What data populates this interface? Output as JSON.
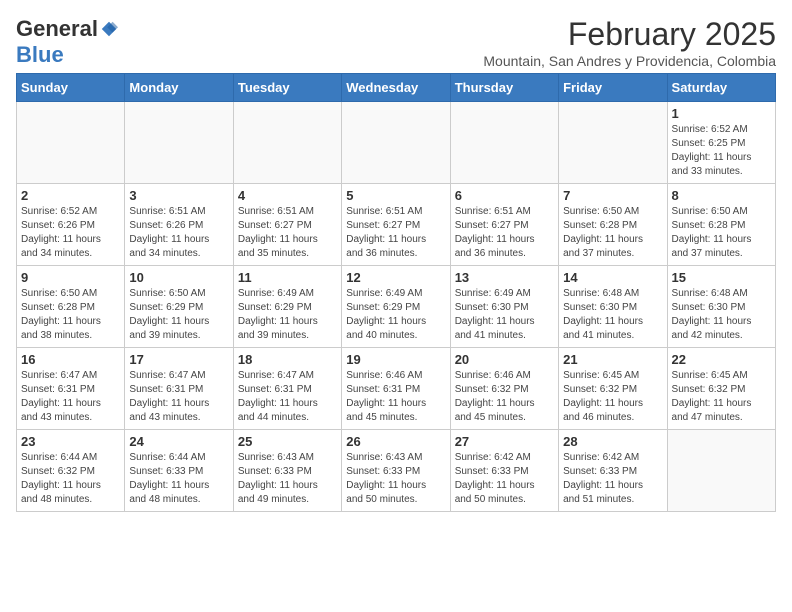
{
  "header": {
    "logo_general": "General",
    "logo_blue": "Blue",
    "month": "February 2025",
    "location": "Mountain, San Andres y Providencia, Colombia"
  },
  "days_of_week": [
    "Sunday",
    "Monday",
    "Tuesday",
    "Wednesday",
    "Thursday",
    "Friday",
    "Saturday"
  ],
  "weeks": [
    [
      {
        "day": "",
        "info": ""
      },
      {
        "day": "",
        "info": ""
      },
      {
        "day": "",
        "info": ""
      },
      {
        "day": "",
        "info": ""
      },
      {
        "day": "",
        "info": ""
      },
      {
        "day": "",
        "info": ""
      },
      {
        "day": "1",
        "info": "Sunrise: 6:52 AM\nSunset: 6:25 PM\nDaylight: 11 hours\nand 33 minutes."
      }
    ],
    [
      {
        "day": "2",
        "info": "Sunrise: 6:52 AM\nSunset: 6:26 PM\nDaylight: 11 hours\nand 34 minutes."
      },
      {
        "day": "3",
        "info": "Sunrise: 6:51 AM\nSunset: 6:26 PM\nDaylight: 11 hours\nand 34 minutes."
      },
      {
        "day": "4",
        "info": "Sunrise: 6:51 AM\nSunset: 6:27 PM\nDaylight: 11 hours\nand 35 minutes."
      },
      {
        "day": "5",
        "info": "Sunrise: 6:51 AM\nSunset: 6:27 PM\nDaylight: 11 hours\nand 36 minutes."
      },
      {
        "day": "6",
        "info": "Sunrise: 6:51 AM\nSunset: 6:27 PM\nDaylight: 11 hours\nand 36 minutes."
      },
      {
        "day": "7",
        "info": "Sunrise: 6:50 AM\nSunset: 6:28 PM\nDaylight: 11 hours\nand 37 minutes."
      },
      {
        "day": "8",
        "info": "Sunrise: 6:50 AM\nSunset: 6:28 PM\nDaylight: 11 hours\nand 37 minutes."
      }
    ],
    [
      {
        "day": "9",
        "info": "Sunrise: 6:50 AM\nSunset: 6:28 PM\nDaylight: 11 hours\nand 38 minutes."
      },
      {
        "day": "10",
        "info": "Sunrise: 6:50 AM\nSunset: 6:29 PM\nDaylight: 11 hours\nand 39 minutes."
      },
      {
        "day": "11",
        "info": "Sunrise: 6:49 AM\nSunset: 6:29 PM\nDaylight: 11 hours\nand 39 minutes."
      },
      {
        "day": "12",
        "info": "Sunrise: 6:49 AM\nSunset: 6:29 PM\nDaylight: 11 hours\nand 40 minutes."
      },
      {
        "day": "13",
        "info": "Sunrise: 6:49 AM\nSunset: 6:30 PM\nDaylight: 11 hours\nand 41 minutes."
      },
      {
        "day": "14",
        "info": "Sunrise: 6:48 AM\nSunset: 6:30 PM\nDaylight: 11 hours\nand 41 minutes."
      },
      {
        "day": "15",
        "info": "Sunrise: 6:48 AM\nSunset: 6:30 PM\nDaylight: 11 hours\nand 42 minutes."
      }
    ],
    [
      {
        "day": "16",
        "info": "Sunrise: 6:47 AM\nSunset: 6:31 PM\nDaylight: 11 hours\nand 43 minutes."
      },
      {
        "day": "17",
        "info": "Sunrise: 6:47 AM\nSunset: 6:31 PM\nDaylight: 11 hours\nand 43 minutes."
      },
      {
        "day": "18",
        "info": "Sunrise: 6:47 AM\nSunset: 6:31 PM\nDaylight: 11 hours\nand 44 minutes."
      },
      {
        "day": "19",
        "info": "Sunrise: 6:46 AM\nSunset: 6:31 PM\nDaylight: 11 hours\nand 45 minutes."
      },
      {
        "day": "20",
        "info": "Sunrise: 6:46 AM\nSunset: 6:32 PM\nDaylight: 11 hours\nand 45 minutes."
      },
      {
        "day": "21",
        "info": "Sunrise: 6:45 AM\nSunset: 6:32 PM\nDaylight: 11 hours\nand 46 minutes."
      },
      {
        "day": "22",
        "info": "Sunrise: 6:45 AM\nSunset: 6:32 PM\nDaylight: 11 hours\nand 47 minutes."
      }
    ],
    [
      {
        "day": "23",
        "info": "Sunrise: 6:44 AM\nSunset: 6:32 PM\nDaylight: 11 hours\nand 48 minutes."
      },
      {
        "day": "24",
        "info": "Sunrise: 6:44 AM\nSunset: 6:33 PM\nDaylight: 11 hours\nand 48 minutes."
      },
      {
        "day": "25",
        "info": "Sunrise: 6:43 AM\nSunset: 6:33 PM\nDaylight: 11 hours\nand 49 minutes."
      },
      {
        "day": "26",
        "info": "Sunrise: 6:43 AM\nSunset: 6:33 PM\nDaylight: 11 hours\nand 50 minutes."
      },
      {
        "day": "27",
        "info": "Sunrise: 6:42 AM\nSunset: 6:33 PM\nDaylight: 11 hours\nand 50 minutes."
      },
      {
        "day": "28",
        "info": "Sunrise: 6:42 AM\nSunset: 6:33 PM\nDaylight: 11 hours\nand 51 minutes."
      },
      {
        "day": "",
        "info": ""
      }
    ]
  ]
}
